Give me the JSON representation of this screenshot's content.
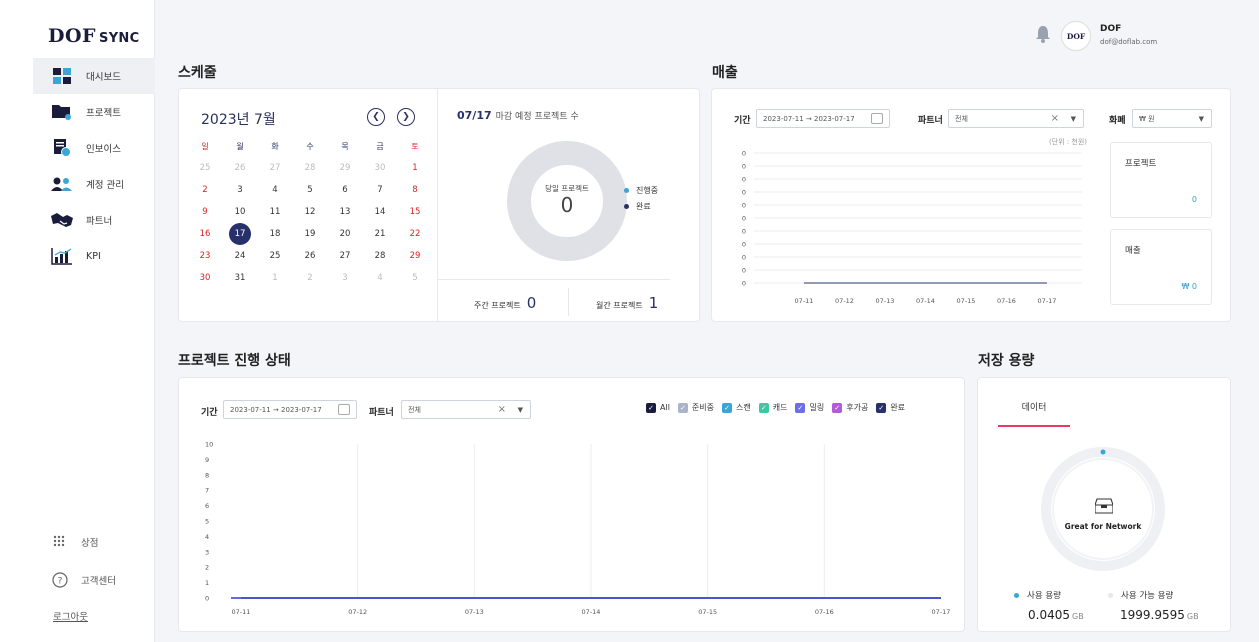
{
  "brand": {
    "logo_main": "DOF",
    "logo_sub": "SYNC"
  },
  "user": {
    "name": "DOF",
    "email": "dof@doflab.com",
    "avatar_text": "DOF"
  },
  "sidebar": {
    "items": [
      {
        "label": "대시보드",
        "icon": "dashboard-icon",
        "active": true
      },
      {
        "label": "프로젝트",
        "icon": "project-folder-icon"
      },
      {
        "label": "인보이스",
        "icon": "invoice-icon"
      },
      {
        "label": "계정 관리",
        "icon": "users-icon"
      },
      {
        "label": "파트너",
        "icon": "handshake-icon"
      },
      {
        "label": "KPI",
        "icon": "kpi-chart-icon"
      }
    ],
    "bottom": [
      {
        "label": "상점",
        "icon": "grid-icon"
      },
      {
        "label": "고객센터",
        "icon": "help-icon"
      }
    ],
    "logout": "로그아웃"
  },
  "schedule": {
    "title": "스케줄",
    "month_label": "2023년 7월",
    "weekdays": [
      "일",
      "월",
      "화",
      "수",
      "목",
      "금",
      "토"
    ],
    "days": [
      [
        "25",
        "26",
        "27",
        "28",
        "29",
        "30",
        "1"
      ],
      [
        "2",
        "3",
        "4",
        "5",
        "6",
        "7",
        "8"
      ],
      [
        "9",
        "10",
        "11",
        "12",
        "13",
        "14",
        "15"
      ],
      [
        "16",
        "17",
        "18",
        "19",
        "20",
        "21",
        "22"
      ],
      [
        "23",
        "24",
        "25",
        "26",
        "27",
        "28",
        "29"
      ],
      [
        "30",
        "31",
        "1",
        "2",
        "3",
        "4",
        "5"
      ]
    ],
    "today": "17",
    "deadline_date": "07/17",
    "deadline_text": "마감 예정 프로젝트 수",
    "donut_label": "당일 프로젝트",
    "donut_value": "0",
    "legend": [
      {
        "label": "진행중",
        "color": "#3aa5d8"
      },
      {
        "label": "완료",
        "color": "#27306a"
      }
    ],
    "weekly_label": "주간 프로젝트",
    "weekly_value": "0",
    "monthly_label": "월간 프로젝트",
    "monthly_value": "1"
  },
  "sales": {
    "title": "매출",
    "period_label": "기간",
    "period_value": "2023-07-11  →  2023-07-17",
    "partner_label": "파트너",
    "partner_value": "전체",
    "currency_label": "화폐",
    "currency_value": "₩ 원",
    "unit_note": "(단위 : 천원)",
    "project_label": "프로젝트",
    "project_value": "0",
    "revenue_label": "매출",
    "revenue_value": "₩ 0"
  },
  "progress": {
    "title": "프로젝트 진행 상태",
    "period_label": "기간",
    "period_value": "2023-07-11  →  2023-07-17",
    "partner_label": "파트너",
    "partner_value": "전체",
    "filters": [
      {
        "label": "All",
        "color": "#1a1c3b"
      },
      {
        "label": "준비중",
        "color": "#a9b3c9"
      },
      {
        "label": "스캔",
        "color": "#3aa5d8"
      },
      {
        "label": "캐드",
        "color": "#3fc8a0"
      },
      {
        "label": "밀링",
        "color": "#6a6ee8"
      },
      {
        "label": "후가공",
        "color": "#b25ad8"
      },
      {
        "label": "완료",
        "color": "#27306a"
      }
    ]
  },
  "storage": {
    "title": "저장 용량",
    "tab_label": "데이터",
    "center_text": "Great for Network",
    "used_label": "사용 용량",
    "used_value": "0.0405",
    "available_label": "사용 가능 용량",
    "available_value": "1999.9595",
    "unit": "GB"
  },
  "chart_data": [
    {
      "type": "line",
      "x": [
        "07-11",
        "07-12",
        "07-13",
        "07-14",
        "07-15",
        "07-16",
        "07-17"
      ],
      "y_ticks": [
        "0",
        "0",
        "0",
        "0",
        "0",
        "0",
        "0",
        "0",
        "0",
        "0",
        "0"
      ],
      "series": [
        {
          "values": [
            0,
            0,
            0,
            0,
            0,
            0,
            0
          ]
        }
      ],
      "xlabel": "",
      "ylabel": ""
    },
    {
      "type": "line",
      "x": [
        "07-11",
        "07-12",
        "07-13",
        "07-14",
        "07-15",
        "07-16",
        "07-17"
      ],
      "y_ticks": [
        "0",
        "1",
        "2",
        "3",
        "4",
        "5",
        "6",
        "7",
        "8",
        "9",
        "10"
      ],
      "ylim": [
        0,
        10
      ],
      "series": [
        {
          "values": [
            0,
            0,
            0,
            0,
            0,
            0,
            0
          ]
        }
      ],
      "xlabel": "",
      "ylabel": ""
    }
  ]
}
